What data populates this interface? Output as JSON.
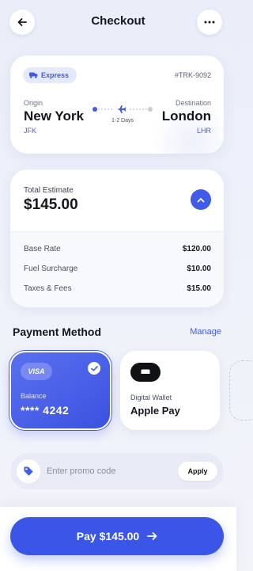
{
  "header": {
    "title": "Checkout",
    "back_icon": "arrow-left-icon",
    "more_icon": "more-horizontal-icon"
  },
  "shipment": {
    "service_label": "Express",
    "service_icon": "truck-icon",
    "tracking_id": "#TRK-9092",
    "origin": {
      "label": "Origin",
      "city": "New York",
      "code": "JFK"
    },
    "destination": {
      "label": "Destination",
      "city": "London",
      "code": "LHR"
    },
    "duration": "1-2 Days"
  },
  "estimate": {
    "label": "Total Estimate",
    "total": "$145.00",
    "fees": [
      {
        "name": "Base Rate",
        "amount": "$120.00"
      },
      {
        "name": "Fuel Surcharge",
        "amount": "$10.00"
      },
      {
        "name": "Taxes & Fees",
        "amount": "$15.00"
      }
    ]
  },
  "payment": {
    "title": "Payment Method",
    "manage_label": "Manage",
    "card": {
      "brand": "VISA",
      "balance_label": "Balance",
      "number": "**** 4242",
      "selected": true
    },
    "wallet": {
      "label": "Digital Wallet",
      "name": "Apple Pay"
    }
  },
  "promo": {
    "placeholder": "Enter promo code",
    "value": "",
    "apply_label": "Apply"
  },
  "pay_button": {
    "label": "Pay $145.00"
  },
  "colors": {
    "accent": "#3f5be8",
    "background": "#eef1fa",
    "card": "#ffffff"
  }
}
